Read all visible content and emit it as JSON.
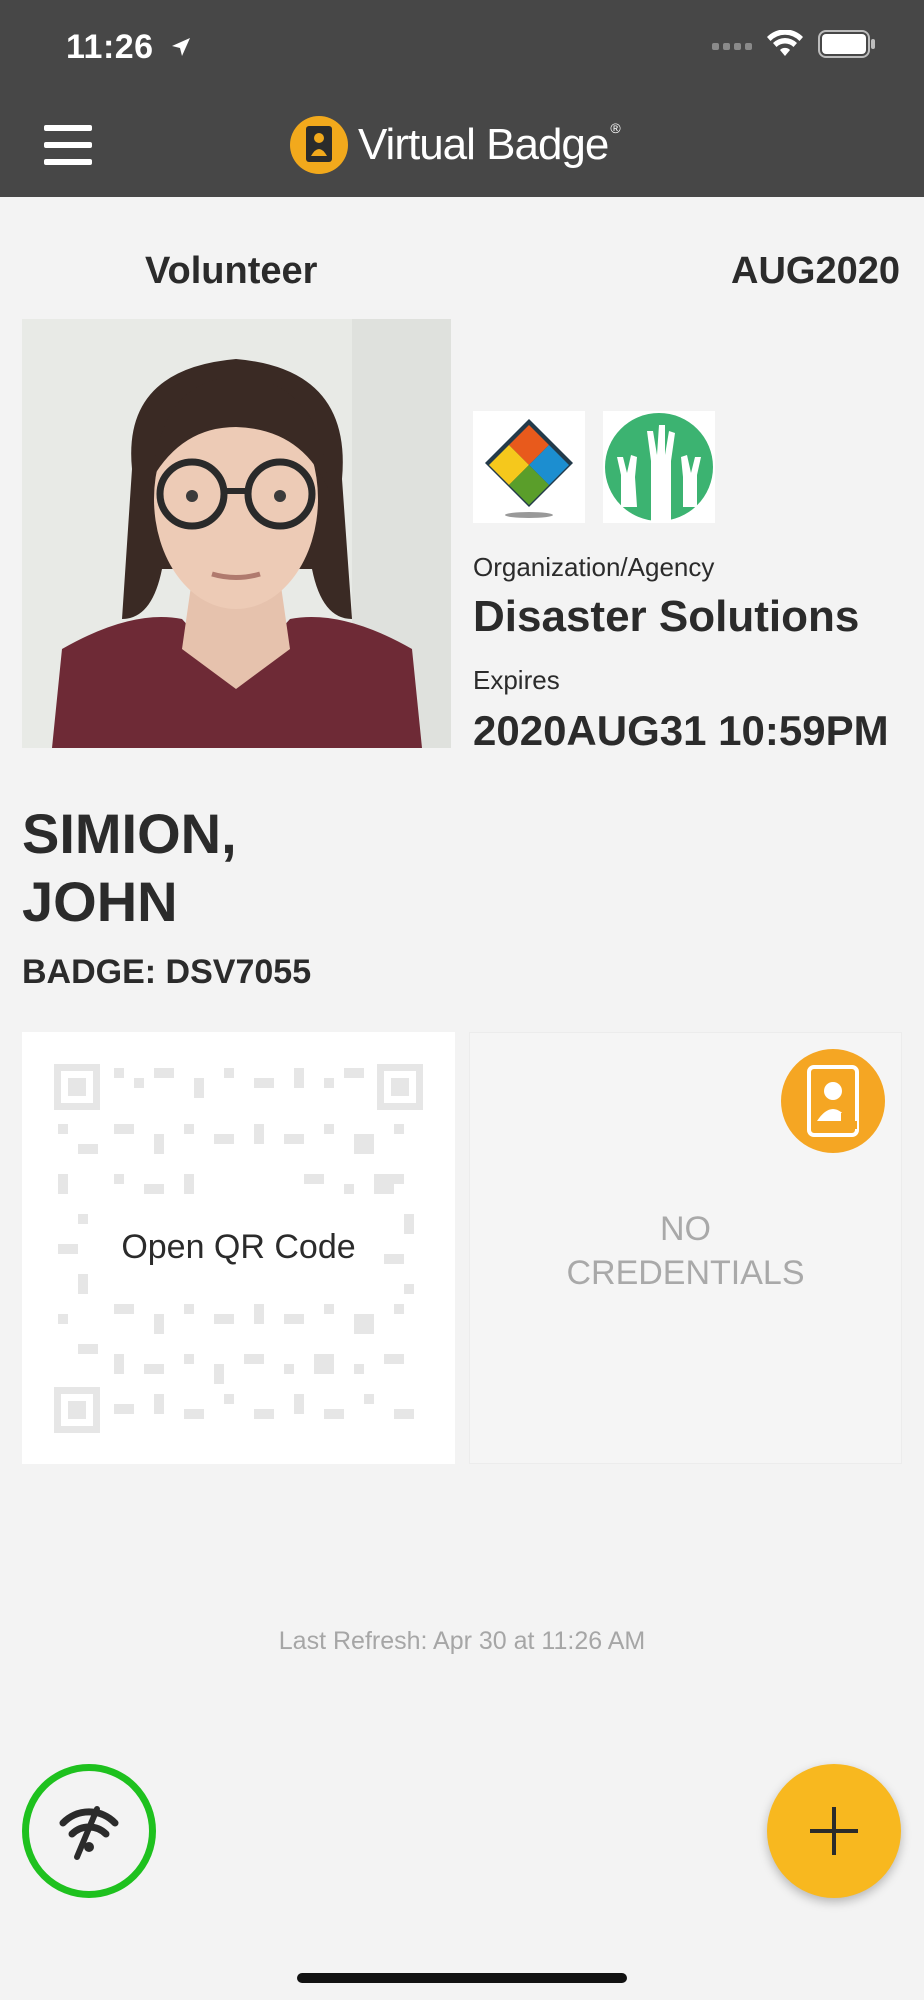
{
  "status_bar": {
    "time": "11:26"
  },
  "header": {
    "app_name": "Virtual Badge",
    "trademark": "®"
  },
  "badge": {
    "role": "Volunteer",
    "period": "AUG2020",
    "org_label": "Organization/Agency",
    "org_name": "Disaster Solutions",
    "expires_label": "Expires",
    "expires_value": "2020AUG31 10:59PM",
    "last_name": "SIMION,",
    "first_name": "JOHN",
    "badge_id": "BADGE: DSV7055"
  },
  "qr": {
    "label": "Open QR Code"
  },
  "credentials": {
    "line1": "NO",
    "line2": "CREDENTIALS"
  },
  "footer": {
    "last_refresh": "Last Refresh: Apr 30 at 11:26 AM"
  },
  "colors": {
    "topbar": "#474747",
    "accent": "#f8b81f",
    "online": "#1ec11e",
    "background": "#f3f3f3"
  },
  "icons": {
    "menu": "hamburger-icon",
    "add": "plus-icon",
    "connection": "wifi-off-icon",
    "credential": "badge-id-icon"
  }
}
